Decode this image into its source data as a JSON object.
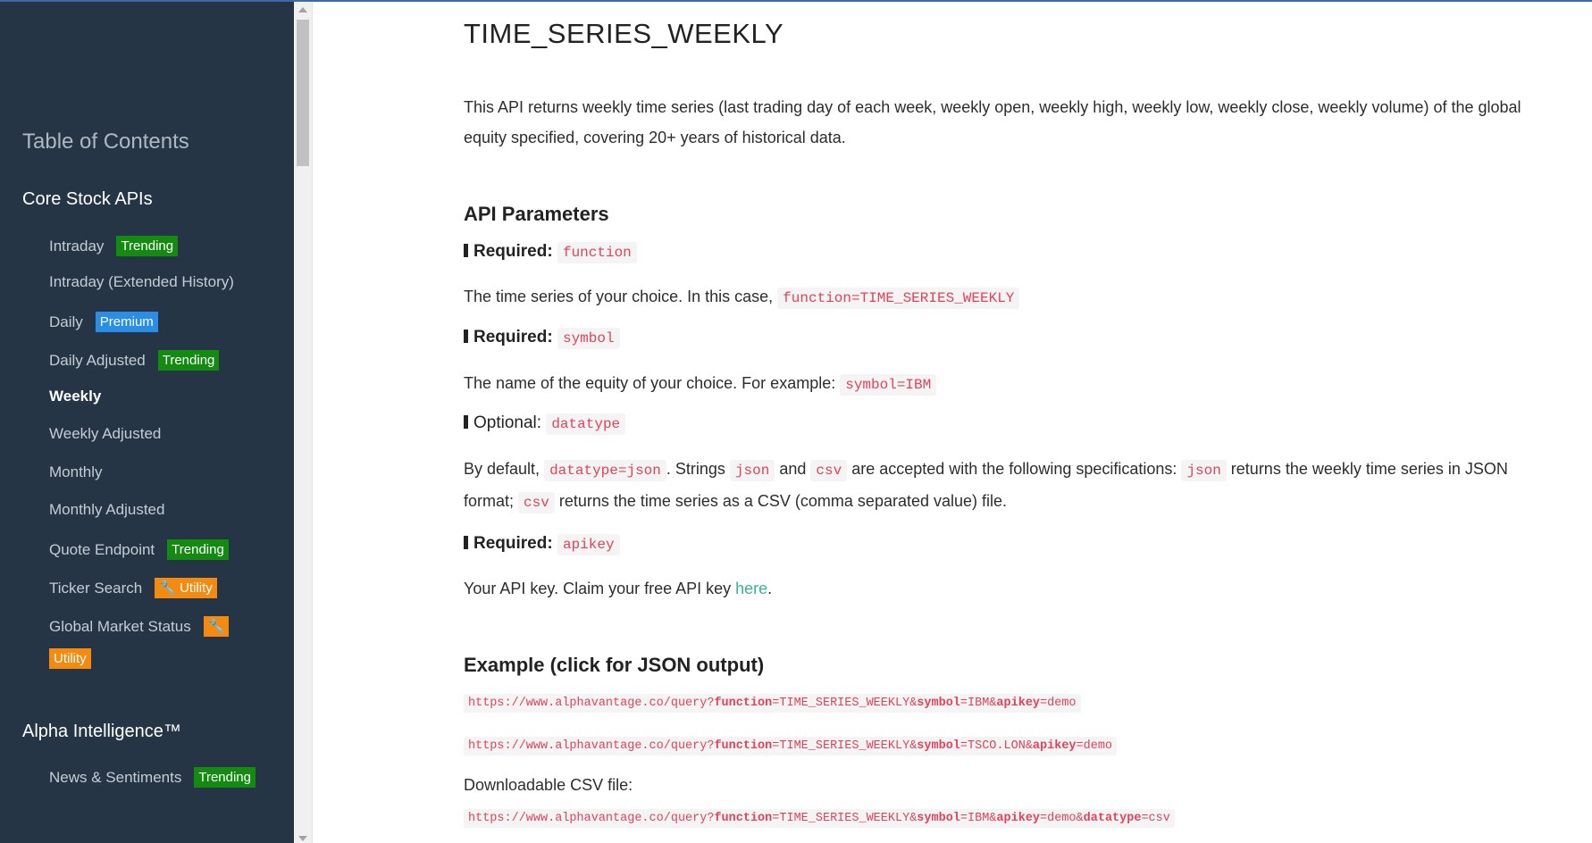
{
  "sidebar": {
    "toc_title": "Table of Contents",
    "sections": [
      {
        "title": "Core Stock APIs"
      },
      {
        "title": "Alpha Intelligence™"
      }
    ],
    "items": [
      {
        "label": "Intraday",
        "badge": "Trending"
      },
      {
        "label": "Intraday (Extended History)"
      },
      {
        "label": "Daily",
        "badge": "Premium"
      },
      {
        "label": "Daily Adjusted",
        "badge": "Trending"
      },
      {
        "label": "Weekly"
      },
      {
        "label": "Weekly Adjusted"
      },
      {
        "label": "Monthly"
      },
      {
        "label": "Monthly Adjusted"
      },
      {
        "label": "Quote Endpoint",
        "badge": "Trending"
      },
      {
        "label": "Ticker Search",
        "badge": "🔧 Utility"
      },
      {
        "label": "Global Market Status",
        "badge_icon": "🔧",
        "badge": "Utility"
      },
      {
        "label": "News & Sentiments",
        "badge": "Trending"
      }
    ]
  },
  "main": {
    "title": "TIME_SERIES_WEEKLY",
    "description": "This API returns weekly time series (last trading day of each week, weekly open, weekly high, weekly low, weekly close, weekly volume) of the global equity specified, covering 20+ years of historical data.",
    "params_heading": "API Parameters",
    "params": [
      {
        "kind": "Required:",
        "name": "function",
        "desc_before": "The time series of your choice. In this case, ",
        "desc_code": "function=TIME_SERIES_WEEKLY"
      },
      {
        "kind": "Required:",
        "name": "symbol",
        "desc_before": "The name of the equity of your choice. For example: ",
        "desc_code": "symbol=IBM"
      },
      {
        "kind": "Optional:",
        "name": "datatype",
        "desc_t1": "By default, ",
        "desc_c1": "datatype=json",
        "desc_t2": ". Strings ",
        "desc_c2": "json",
        "desc_t3": " and ",
        "desc_c3": "csv",
        "desc_t4": " are accepted with the following specifications: ",
        "desc_c4": "json",
        "desc_t5": " returns the weekly time series in JSON format; ",
        "desc_c5": "csv",
        "desc_t6": " returns the time series as a CSV (comma separated value) file."
      },
      {
        "kind": "Required:",
        "name": "apikey",
        "desc_before": "Your API key. Claim your free API key ",
        "desc_link": "here",
        "desc_after": "."
      }
    ],
    "example_heading": "Example (click for JSON output)",
    "urls": [
      {
        "base": "https://www.alphavantage.co/query?",
        "k1": "function",
        "v1": "=TIME_SERIES_WEEKLY&",
        "k2": "symbol",
        "v2": "=IBM&",
        "k3": "apikey",
        "v3": "=demo"
      },
      {
        "base": "https://www.alphavantage.co/query?",
        "k1": "function",
        "v1": "=TIME_SERIES_WEEKLY&",
        "k2": "symbol",
        "v2": "=TSCO.LON&",
        "k3": "apikey",
        "v3": "=demo"
      },
      {
        "base": "https://www.alphavantage.co/query?",
        "k1": "function",
        "v1": "=TIME_SERIES_WEEKLY&",
        "k2": "symbol",
        "v2": "=IBM&",
        "k3": "apikey",
        "v3": "=demo&",
        "k4": "datatype",
        "v4": "=csv"
      }
    ],
    "csv_label": "Downloadable CSV file:"
  },
  "colors": {
    "sidebar_bg": "#263545",
    "trending": "#138a10",
    "premium": "#2a8ee6",
    "utility": "#f28b10",
    "code_text": "#e2435b",
    "link": "#38b39b"
  }
}
